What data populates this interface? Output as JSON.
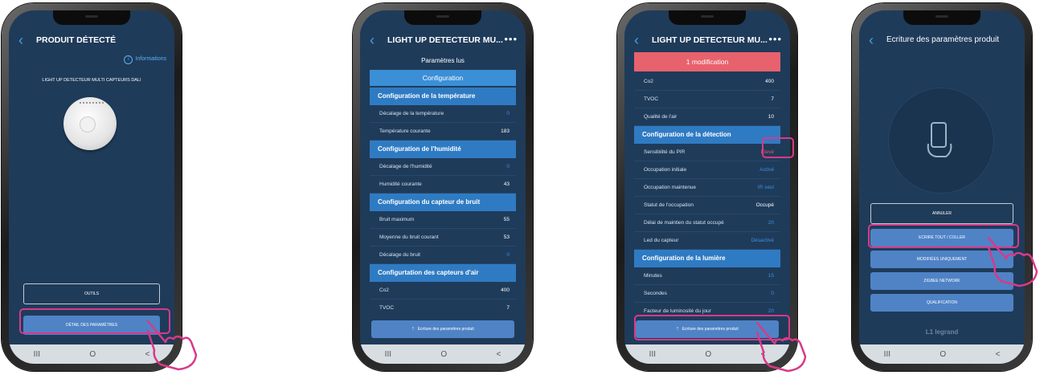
{
  "screens": {
    "s1": {
      "title": "PRODUIT DÉTECTÉ",
      "info_link": "Informations",
      "product_name": "LIGHT UP DETECTEUR MULTI CAPTEURS DALI",
      "tools_button": "OUTILS",
      "detail_button": "DÉTAIL DES PARAMÈTRES"
    },
    "s2": {
      "title": "LIGHT UP DETECTEUR MU...",
      "subtitle": "Paramètres lus",
      "config_tab": "Configuration",
      "sections": [
        {
          "title": "Configuration de la température",
          "rows": [
            {
              "label": "Décalage de la température",
              "value": "0"
            },
            {
              "label": "Température courante",
              "value": "183"
            }
          ]
        },
        {
          "title": "Configuration de l'humidité",
          "rows": [
            {
              "label": "Décalage de l'humidité",
              "value": "0"
            },
            {
              "label": "Humidité courante",
              "value": "43"
            }
          ]
        },
        {
          "title": "Configuration du capteur de bruit",
          "rows": [
            {
              "label": "Bruit maximum",
              "value": "55"
            },
            {
              "label": "Moyenne du bruit courant",
              "value": "53"
            },
            {
              "label": "Décalage du bruit",
              "value": "0"
            }
          ]
        },
        {
          "title": "Configurtation des capteurs d'air",
          "rows": [
            {
              "label": "Co2",
              "value": "400"
            },
            {
              "label": "TVOC",
              "value": "7"
            }
          ]
        }
      ],
      "write_button": "Ecriture des paramètres produit"
    },
    "s3": {
      "title": "LIGHT UP DETECTEUR MU...",
      "modification_banner": "1 modification",
      "top_rows": [
        {
          "label": "Co2",
          "value": "400"
        },
        {
          "label": "TVOC",
          "value": "7"
        },
        {
          "label": "Qualité de l'air",
          "value": "10"
        }
      ],
      "detection_title": "Configuration de la détection",
      "detection_rows": [
        {
          "label": "Sensibilité du PIR",
          "value": "Élevé"
        },
        {
          "label": "Occupation initiale",
          "value": "Activé"
        },
        {
          "label": "Occupation maintenue",
          "value": "IR seul"
        },
        {
          "label": "Statut de l'occupation",
          "value": "Occupé"
        },
        {
          "label": "Délai de maintien du statut occupé",
          "value": "20"
        },
        {
          "label": "Led du capteur",
          "value": "Désactivé"
        }
      ],
      "light_title": "Configuration de la lumière",
      "light_rows": [
        {
          "label": "Minutes",
          "value": "15"
        },
        {
          "label": "Secondes",
          "value": "0"
        },
        {
          "label": "Facteur de luminosité du jour",
          "value": "20"
        }
      ],
      "write_button": "Ecriture des paramètres produit"
    },
    "s4": {
      "title": "Ecriture des paramètres produit",
      "cancel_button": "ANNULER",
      "write_all_button": "ECRIRE TOUT / COLLER",
      "modified_button": "MODIFIÉES UNIQUEMENT",
      "zigbee_button": "ZIGBEE NETWORK",
      "qualification_button": "QUALIFICATION",
      "brand": "L1 legrand"
    }
  },
  "nav": {
    "recent": "III",
    "home": "O",
    "back": "<"
  },
  "colors": {
    "screen_bg": "#1f3b5a",
    "section_blue": "#2f7bc3",
    "banner_red": "#e8626d",
    "highlight_pink": "#d8398a"
  }
}
